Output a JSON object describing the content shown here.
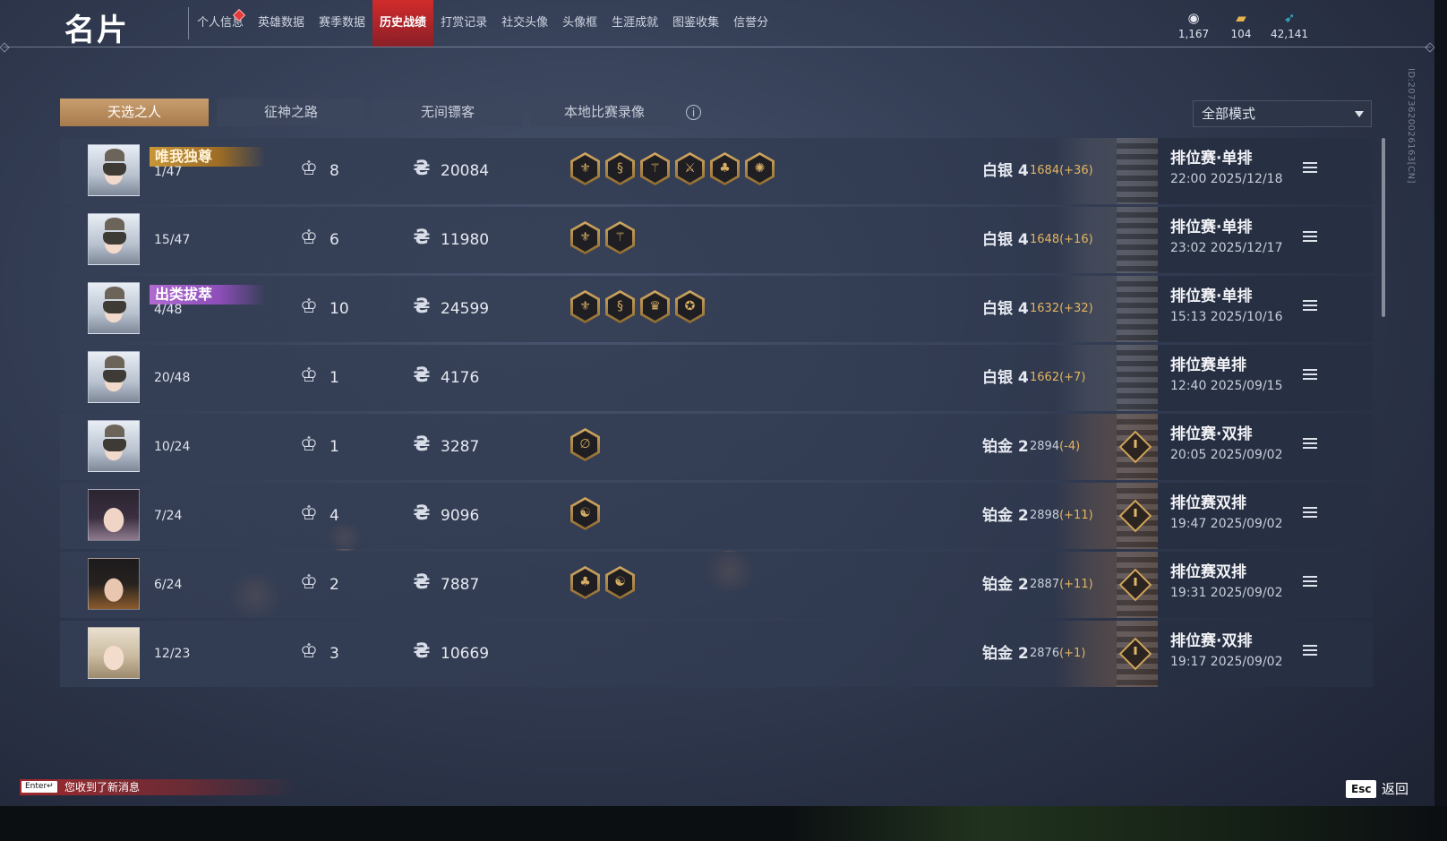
{
  "app": {
    "title": "名片",
    "nav": [
      {
        "label": "个人信息",
        "active": false,
        "badge": true
      },
      {
        "label": "英雄数据",
        "active": false
      },
      {
        "label": "赛季数据",
        "active": false
      },
      {
        "label": "历史战绩",
        "active": true
      },
      {
        "label": "打赏记录",
        "active": false
      },
      {
        "label": "社交头像",
        "active": false
      },
      {
        "label": "头像框",
        "active": false
      },
      {
        "label": "生涯成就",
        "active": false
      },
      {
        "label": "图鉴收集",
        "active": false
      },
      {
        "label": "信誉分",
        "active": false
      }
    ],
    "currencies": [
      {
        "icon": "coin-pile-icon",
        "value": "1,167"
      },
      {
        "icon": "ticket-icon",
        "value": "104"
      },
      {
        "icon": "feather-icon",
        "value": "42,141"
      }
    ],
    "side_id": "ID:2073620026163[CN]"
  },
  "tabs": [
    {
      "label": "天选之人",
      "active": true
    },
    {
      "label": "征神之路",
      "active": false
    },
    {
      "label": "无间镖客",
      "active": false
    },
    {
      "label": "本地比赛录像",
      "active": false
    }
  ],
  "mode_select": {
    "value": "全部模式"
  },
  "matches": [
    {
      "avatar": "veil",
      "title": "唯我独尊",
      "title_style": "gold",
      "rank": "1/47",
      "kills": "8",
      "score": "20084",
      "badges": [
        "⚜",
        "§",
        "⚚",
        "⚔",
        "♣",
        "✺"
      ],
      "tier": "白银 4",
      "rating": "1684",
      "delta": "(+36)",
      "mode": "排位赛·单排",
      "time": "22:00  2025/12/18",
      "plat": false
    },
    {
      "avatar": "veil",
      "title": "",
      "title_style": "",
      "rank": "15/47",
      "kills": "6",
      "score": "11980",
      "badges": [
        "⚜",
        "⚚"
      ],
      "tier": "白银 4",
      "rating": "1648",
      "delta": "(+16)",
      "mode": "排位赛·单排",
      "time": "23:02  2025/12/17",
      "plat": false
    },
    {
      "avatar": "veil",
      "title": "出类拔萃",
      "title_style": "purple",
      "rank": "4/48",
      "kills": "10",
      "score": "24599",
      "badges": [
        "⚜",
        "§",
        "♛",
        "✪"
      ],
      "tier": "白银 4",
      "rating": "1632",
      "delta": "(+32)",
      "mode": "排位赛·单排",
      "time": "15:13  2025/10/16",
      "plat": false
    },
    {
      "avatar": "veil",
      "title": "",
      "title_style": "",
      "rank": "20/48",
      "kills": "1",
      "score": "4176",
      "badges": [],
      "tier": "白银 4",
      "rating": "1662",
      "delta": "(+7)",
      "mode": "排位赛单排",
      "time": "12:40  2025/09/15",
      "plat": false
    },
    {
      "avatar": "veil",
      "title": "",
      "title_style": "",
      "rank": "10/24",
      "kills": "1",
      "score": "3287",
      "badges": [
        "∅"
      ],
      "tier": "铂金 2",
      "rating": "2894",
      "delta": "(-4)",
      "mode": "排位赛·双排",
      "time": "20:05  2025/09/02",
      "plat": true
    },
    {
      "avatar": "dark",
      "title": "",
      "title_style": "",
      "rank": "7/24",
      "kills": "4",
      "score": "9096",
      "badges": [
        "☯"
      ],
      "tier": "铂金 2",
      "rating": "2898",
      "delta": "(+11)",
      "mode": "排位赛双排",
      "time": "19:47  2025/09/02",
      "plat": true
    },
    {
      "avatar": "man",
      "title": "",
      "title_style": "",
      "rank": "6/24",
      "kills": "2",
      "score": "7887",
      "badges": [
        "♣",
        "☯"
      ],
      "tier": "铂金 2",
      "rating": "2887",
      "delta": "(+11)",
      "mode": "排位赛双排",
      "time": "19:31  2025/09/02",
      "plat": true
    },
    {
      "avatar": "light",
      "title": "",
      "title_style": "",
      "rank": "12/23",
      "kills": "3",
      "score": "10669",
      "badges": [],
      "tier": "铂金 2",
      "rating": "2876",
      "delta": "(+1)",
      "mode": "排位赛·双排",
      "time": "19:17  2025/09/02",
      "plat": true
    }
  ],
  "footer": {
    "enter_key": "Enter↵",
    "message": "您收到了新消息",
    "esc_key": "Esc",
    "back_label": "返回"
  }
}
